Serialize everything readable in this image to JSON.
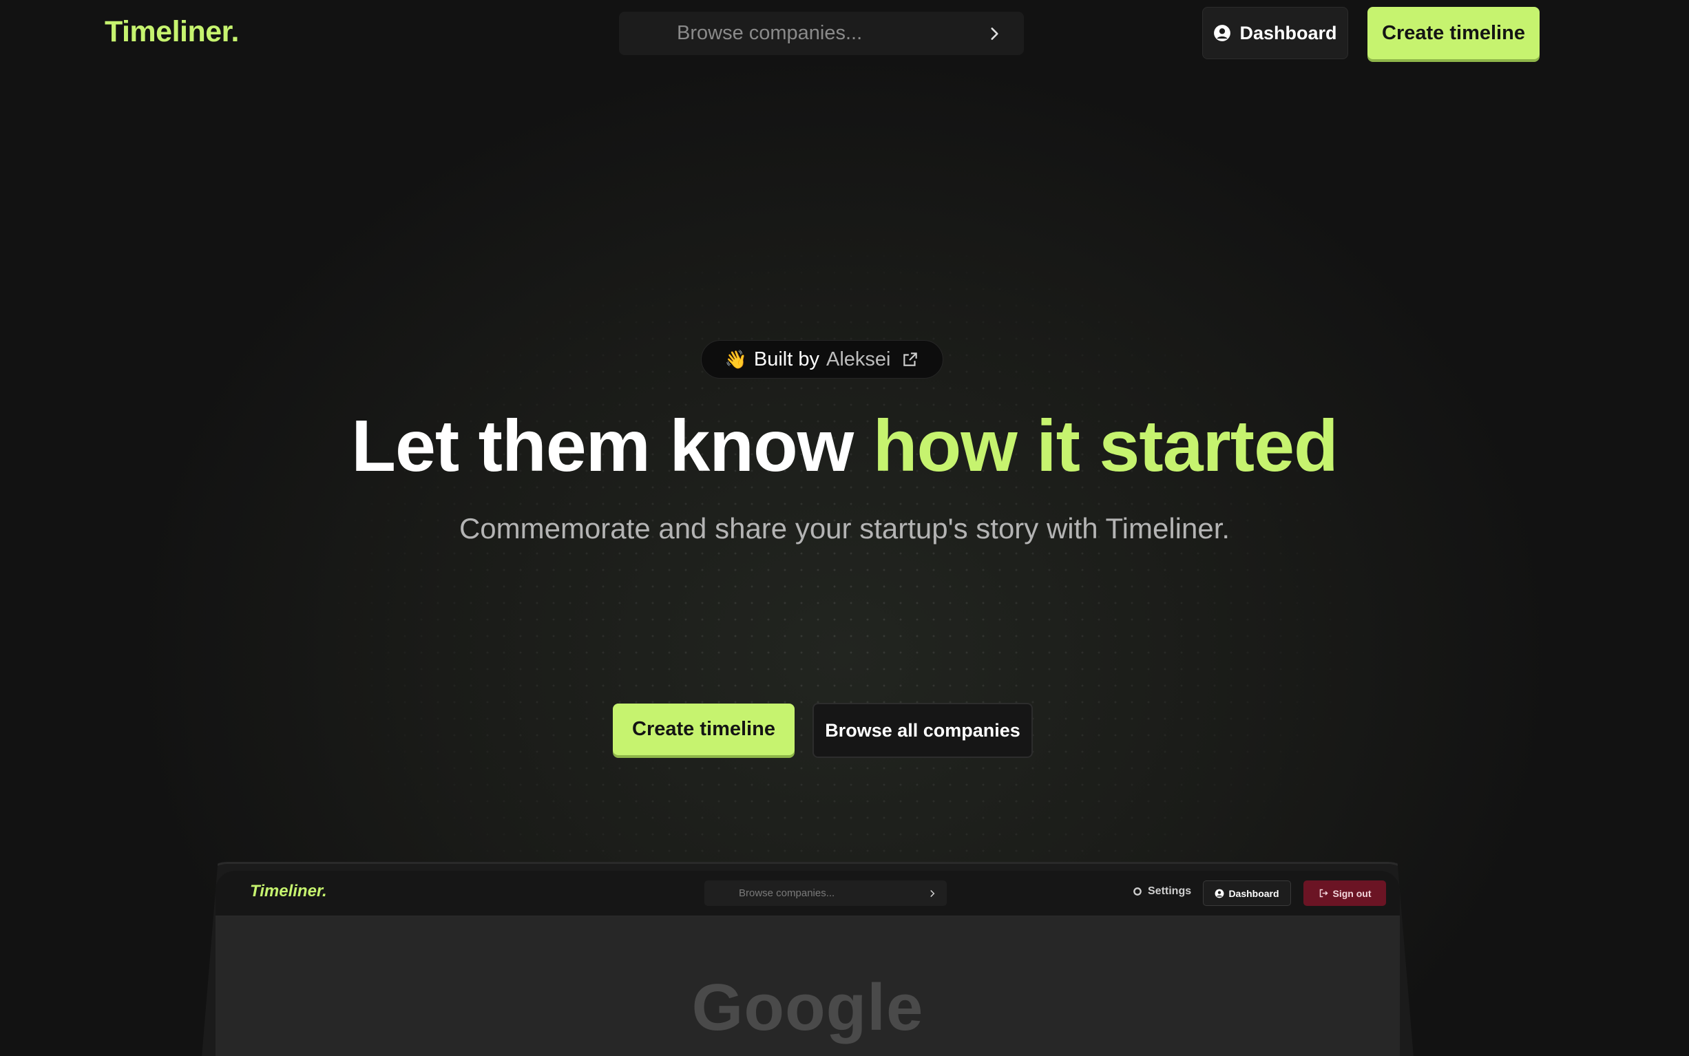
{
  "header": {
    "logo": "Timeliner.",
    "search_placeholder": "Browse companies...",
    "dashboard_label": "Dashboard",
    "create_label": "Create timeline"
  },
  "hero": {
    "pill_prefix": "Built by",
    "pill_author": "Aleksei",
    "headline_plain": "Let them know",
    "headline_accent": "how it started",
    "subtitle": "Commemorate and share your startup's story with Timeliner.",
    "primary_cta": "Create timeline",
    "secondary_cta": "Browse all companies"
  },
  "preview": {
    "logo": "Timeliner.",
    "search_placeholder": "Browse companies...",
    "settings_label": "Settings",
    "dashboard_label": "Dashboard",
    "signout_label": "Sign out",
    "company_name": "Google"
  },
  "colors": {
    "accent": "#c6f36f",
    "background": "#131313",
    "signout": "#6b1424"
  },
  "icons": {
    "search_chevron": "chevron-right-icon",
    "dashboard": "user-circle-icon",
    "pill_wave": "waving-hand-icon",
    "pill_link": "external-link-icon",
    "preview_settings": "gear-icon",
    "preview_signout": "sign-out-icon"
  }
}
